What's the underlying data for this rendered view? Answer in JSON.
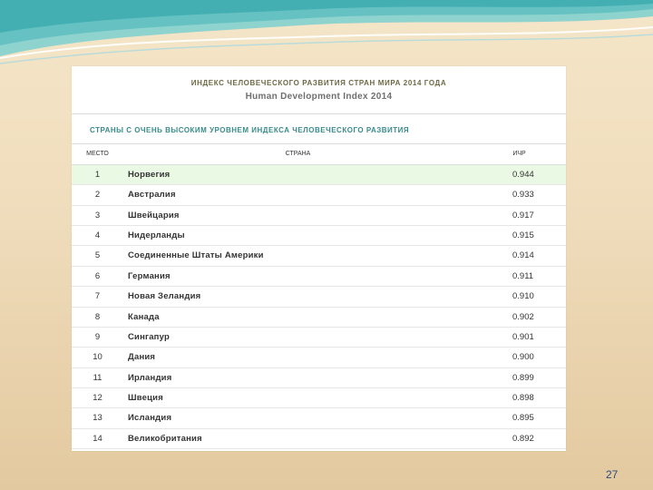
{
  "slide": {
    "page_number": "27"
  },
  "panel": {
    "title_ru": "ИНДЕКС ЧЕЛОВЕЧЕСКОГО РАЗВИТИЯ СТРАН МИРА 2014 ГОДА",
    "title_en": "Human Development Index 2014",
    "subtitle": "СТРАНЫ С ОЧЕНЬ ВЫСОКИМ УРОВНЕМ ИНДЕКСА ЧЕЛОВЕЧЕСКОГО РАЗВИТИЯ"
  },
  "table": {
    "headers": {
      "rank": "МЕСТО",
      "country": "СТРАНА",
      "index": "ИЧР"
    },
    "rows": [
      {
        "rank": "1",
        "country": "Норвегия",
        "index": "0.944"
      },
      {
        "rank": "2",
        "country": "Австралия",
        "index": "0.933"
      },
      {
        "rank": "3",
        "country": "Швейцария",
        "index": "0.917"
      },
      {
        "rank": "4",
        "country": "Нидерланды",
        "index": "0.915"
      },
      {
        "rank": "5",
        "country": "Соединенные Штаты Америки",
        "index": "0.914"
      },
      {
        "rank": "6",
        "country": "Германия",
        "index": "0.911"
      },
      {
        "rank": "7",
        "country": "Новая Зеландия",
        "index": "0.910"
      },
      {
        "rank": "8",
        "country": "Канада",
        "index": "0.902"
      },
      {
        "rank": "9",
        "country": "Сингапур",
        "index": "0.901"
      },
      {
        "rank": "10",
        "country": "Дания",
        "index": "0.900"
      },
      {
        "rank": "11",
        "country": "Ирландия",
        "index": "0.899"
      },
      {
        "rank": "12",
        "country": "Швеция",
        "index": "0.898"
      },
      {
        "rank": "13",
        "country": "Исландия",
        "index": "0.895"
      },
      {
        "rank": "14",
        "country": "Великобритания",
        "index": "0.892"
      }
    ]
  },
  "colors": {
    "highlight_row": "#eaf9e4",
    "subtitle_text": "#3a8b8b",
    "page_number": "#2c4a7a"
  }
}
